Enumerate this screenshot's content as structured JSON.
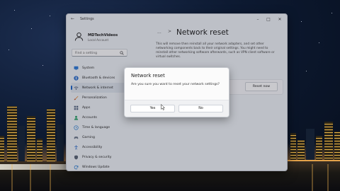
{
  "window": {
    "app_title": "Settings"
  },
  "profile": {
    "name": "MDTechVideos",
    "account_type": "Local Account"
  },
  "search": {
    "placeholder": "Find a setting"
  },
  "sidebar": {
    "items": [
      {
        "label": "System",
        "icon": "monitor-icon",
        "active": false
      },
      {
        "label": "Bluetooth & devices",
        "icon": "bluetooth-icon",
        "active": false
      },
      {
        "label": "Network & internet",
        "icon": "wifi-icon",
        "active": true
      },
      {
        "label": "Personalization",
        "icon": "brush-icon",
        "active": false
      },
      {
        "label": "Apps",
        "icon": "apps-icon",
        "active": false
      },
      {
        "label": "Accounts",
        "icon": "person-icon",
        "active": false
      },
      {
        "label": "Time & language",
        "icon": "globe-clock-icon",
        "active": false
      },
      {
        "label": "Gaming",
        "icon": "controller-icon",
        "active": false
      },
      {
        "label": "Accessibility",
        "icon": "accessibility-icon",
        "active": false
      },
      {
        "label": "Privacy & security",
        "icon": "shield-icon",
        "active": false
      },
      {
        "label": "Windows Update",
        "icon": "update-icon",
        "active": false
      }
    ]
  },
  "main": {
    "breadcrumb_overflow": "...",
    "breadcrumb_separator": ">",
    "page_title": "Network reset",
    "description": "This will remove then reinstall all your network adapters, and set other networking components back to their original settings. You might need to reinstall other networking software afterwards, such as VPN client software or virtual switches.",
    "reset_button_label": "Reset now"
  },
  "dialog": {
    "title": "Network reset",
    "question": "Are you sure you want to reset your network settings?",
    "yes_label": "Yes",
    "no_label": "No"
  },
  "colors": {
    "accent": "#1b64c7",
    "window_bg": "#eef1f6",
    "dialog_bg": "#fbfbfb"
  }
}
